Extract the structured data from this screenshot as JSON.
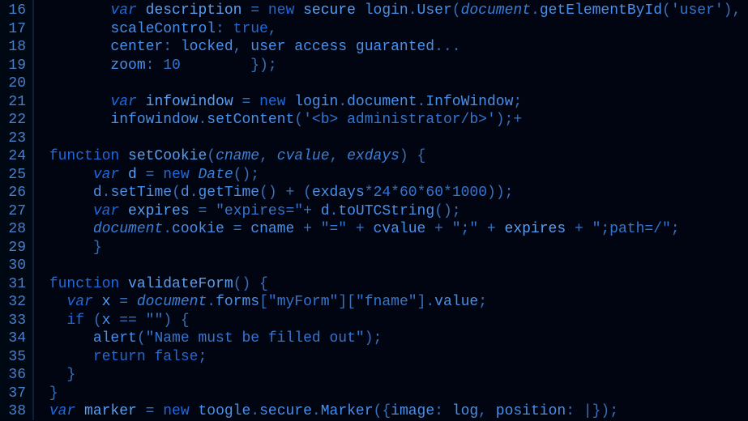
{
  "editor": {
    "startLine": 16,
    "lines": [
      {
        "num": 16,
        "indent": "        ",
        "tokens": [
          {
            "t": "var ",
            "c": "kw"
          },
          {
            "t": "description",
            "c": "bright"
          },
          {
            "t": " = ",
            "c": "punc"
          },
          {
            "t": "new ",
            "c": "kw2"
          },
          {
            "t": "secure ",
            "c": "bright"
          },
          {
            "t": "login",
            "c": "ident"
          },
          {
            "t": ".",
            "c": "punc"
          },
          {
            "t": "User",
            "c": "ident"
          },
          {
            "t": "(",
            "c": "punc"
          },
          {
            "t": "document",
            "c": "param"
          },
          {
            "t": ".",
            "c": "punc"
          },
          {
            "t": "getElementById",
            "c": "ident"
          },
          {
            "t": "(",
            "c": "punc"
          },
          {
            "t": "'user'",
            "c": "str"
          },
          {
            "t": "), {",
            "c": "punc"
          }
        ]
      },
      {
        "num": 17,
        "indent": "        ",
        "tokens": [
          {
            "t": "scaleControl",
            "c": "prop"
          },
          {
            "t": ": ",
            "c": "punc"
          },
          {
            "t": "true",
            "c": "kw2"
          },
          {
            "t": ",",
            "c": "punc"
          }
        ]
      },
      {
        "num": 18,
        "indent": "        ",
        "tokens": [
          {
            "t": "center",
            "c": "prop"
          },
          {
            "t": ": ",
            "c": "punc"
          },
          {
            "t": "locked",
            "c": "ident"
          },
          {
            "t": ", ",
            "c": "punc"
          },
          {
            "t": "user access guaranted",
            "c": "ident"
          },
          {
            "t": "...",
            "c": "punc"
          }
        ]
      },
      {
        "num": 19,
        "indent": "        ",
        "tokens": [
          {
            "t": "zoom",
            "c": "prop"
          },
          {
            "t": ": ",
            "c": "punc"
          },
          {
            "t": "10",
            "c": "num"
          },
          {
            "t": "        });",
            "c": "punc"
          }
        ]
      },
      {
        "num": 20,
        "indent": "",
        "tokens": []
      },
      {
        "num": 21,
        "indent": "        ",
        "tokens": [
          {
            "t": "var ",
            "c": "kw"
          },
          {
            "t": "infowindow",
            "c": "bright"
          },
          {
            "t": " = ",
            "c": "punc"
          },
          {
            "t": "new ",
            "c": "kw2"
          },
          {
            "t": "login",
            "c": "ident"
          },
          {
            "t": ".",
            "c": "punc"
          },
          {
            "t": "document",
            "c": "ident"
          },
          {
            "t": ".",
            "c": "punc"
          },
          {
            "t": "InfoWindow",
            "c": "ident"
          },
          {
            "t": ";",
            "c": "punc"
          }
        ]
      },
      {
        "num": 22,
        "indent": "        ",
        "tokens": [
          {
            "t": "infowindow",
            "c": "ident"
          },
          {
            "t": ".",
            "c": "punc"
          },
          {
            "t": "setContent",
            "c": "ident"
          },
          {
            "t": "(",
            "c": "punc"
          },
          {
            "t": "'<b> administrator/b>'",
            "c": "str"
          },
          {
            "t": ");+",
            "c": "punc"
          }
        ]
      },
      {
        "num": 23,
        "indent": "",
        "tokens": []
      },
      {
        "num": 24,
        "indent": " ",
        "tokens": [
          {
            "t": "function ",
            "c": "kw2"
          },
          {
            "t": "setCookie",
            "c": "bright"
          },
          {
            "t": "(",
            "c": "punc"
          },
          {
            "t": "cname",
            "c": "param"
          },
          {
            "t": ", ",
            "c": "punc"
          },
          {
            "t": "cvalue",
            "c": "param"
          },
          {
            "t": ", ",
            "c": "punc"
          },
          {
            "t": "exdays",
            "c": "param"
          },
          {
            "t": ") {",
            "c": "punc"
          }
        ]
      },
      {
        "num": 25,
        "indent": "      ",
        "tokens": [
          {
            "t": "var ",
            "c": "kw"
          },
          {
            "t": "d",
            "c": "bright"
          },
          {
            "t": " = ",
            "c": "punc"
          },
          {
            "t": "new ",
            "c": "kw2"
          },
          {
            "t": "Date",
            "c": "type"
          },
          {
            "t": "();",
            "c": "punc"
          }
        ]
      },
      {
        "num": 26,
        "indent": "      ",
        "tokens": [
          {
            "t": "d",
            "c": "ident"
          },
          {
            "t": ".",
            "c": "punc"
          },
          {
            "t": "setTime",
            "c": "ident"
          },
          {
            "t": "(",
            "c": "punc"
          },
          {
            "t": "d",
            "c": "ident"
          },
          {
            "t": ".",
            "c": "punc"
          },
          {
            "t": "getTime",
            "c": "ident"
          },
          {
            "t": "() + (",
            "c": "punc"
          },
          {
            "t": "exdays",
            "c": "ident"
          },
          {
            "t": "*",
            "c": "punc"
          },
          {
            "t": "24",
            "c": "num"
          },
          {
            "t": "*",
            "c": "punc"
          },
          {
            "t": "60",
            "c": "num"
          },
          {
            "t": "*",
            "c": "punc"
          },
          {
            "t": "60",
            "c": "num"
          },
          {
            "t": "*",
            "c": "punc"
          },
          {
            "t": "1000",
            "c": "num"
          },
          {
            "t": "));",
            "c": "punc"
          }
        ]
      },
      {
        "num": 27,
        "indent": "      ",
        "tokens": [
          {
            "t": "var ",
            "c": "kw"
          },
          {
            "t": "expires",
            "c": "bright"
          },
          {
            "t": " = ",
            "c": "punc"
          },
          {
            "t": "\"expires=\"",
            "c": "str"
          },
          {
            "t": "+ ",
            "c": "punc"
          },
          {
            "t": "d",
            "c": "ident"
          },
          {
            "t": ".",
            "c": "punc"
          },
          {
            "t": "toUTCString",
            "c": "ident"
          },
          {
            "t": "();",
            "c": "punc"
          }
        ]
      },
      {
        "num": 28,
        "indent": "      ",
        "tokens": [
          {
            "t": "document",
            "c": "param"
          },
          {
            "t": ".",
            "c": "punc"
          },
          {
            "t": "cookie",
            "c": "ident"
          },
          {
            "t": " = ",
            "c": "punc"
          },
          {
            "t": "cname",
            "c": "ident"
          },
          {
            "t": " + ",
            "c": "punc"
          },
          {
            "t": "\"=\"",
            "c": "str"
          },
          {
            "t": " + ",
            "c": "punc"
          },
          {
            "t": "cvalue",
            "c": "ident"
          },
          {
            "t": " + ",
            "c": "punc"
          },
          {
            "t": "\";\"",
            "c": "str"
          },
          {
            "t": " + ",
            "c": "punc"
          },
          {
            "t": "expires",
            "c": "bright"
          },
          {
            "t": " + ",
            "c": "punc"
          },
          {
            "t": "\";path=/\"",
            "c": "str"
          },
          {
            "t": ";",
            "c": "punc"
          }
        ]
      },
      {
        "num": 29,
        "indent": "      ",
        "tokens": [
          {
            "t": "}",
            "c": "punc"
          }
        ]
      },
      {
        "num": 30,
        "indent": "",
        "tokens": []
      },
      {
        "num": 31,
        "indent": " ",
        "tokens": [
          {
            "t": "function ",
            "c": "kw2"
          },
          {
            "t": "validateForm",
            "c": "bright"
          },
          {
            "t": "() {",
            "c": "punc"
          }
        ]
      },
      {
        "num": 32,
        "indent": "   ",
        "tokens": [
          {
            "t": "var ",
            "c": "kw"
          },
          {
            "t": "x",
            "c": "bright"
          },
          {
            "t": " = ",
            "c": "punc"
          },
          {
            "t": "document",
            "c": "param"
          },
          {
            "t": ".",
            "c": "punc"
          },
          {
            "t": "forms",
            "c": "ident"
          },
          {
            "t": "[",
            "c": "punc"
          },
          {
            "t": "\"myForm\"",
            "c": "str"
          },
          {
            "t": "][",
            "c": "punc"
          },
          {
            "t": "\"fname\"",
            "c": "str"
          },
          {
            "t": "].",
            "c": "punc"
          },
          {
            "t": "value",
            "c": "ident"
          },
          {
            "t": ";",
            "c": "punc"
          }
        ]
      },
      {
        "num": 33,
        "indent": "   ",
        "tokens": [
          {
            "t": "if ",
            "c": "kw2"
          },
          {
            "t": "(",
            "c": "punc"
          },
          {
            "t": "x",
            "c": "ident"
          },
          {
            "t": " == ",
            "c": "punc"
          },
          {
            "t": "\"\"",
            "c": "str"
          },
          {
            "t": ") {",
            "c": "punc"
          }
        ]
      },
      {
        "num": 34,
        "indent": "      ",
        "tokens": [
          {
            "t": "alert",
            "c": "ident"
          },
          {
            "t": "(",
            "c": "punc"
          },
          {
            "t": "\"Name must be filled out\"",
            "c": "str"
          },
          {
            "t": ");",
            "c": "punc"
          }
        ]
      },
      {
        "num": 35,
        "indent": "      ",
        "tokens": [
          {
            "t": "return ",
            "c": "kw2"
          },
          {
            "t": "false",
            "c": "kw2"
          },
          {
            "t": ";",
            "c": "punc"
          }
        ]
      },
      {
        "num": 36,
        "indent": "   ",
        "tokens": [
          {
            "t": "}",
            "c": "punc"
          }
        ]
      },
      {
        "num": 37,
        "indent": " ",
        "tokens": [
          {
            "t": "}",
            "c": "punc"
          }
        ]
      },
      {
        "num": 38,
        "indent": " ",
        "tokens": [
          {
            "t": "var ",
            "c": "kw"
          },
          {
            "t": "marker",
            "c": "bright"
          },
          {
            "t": " = ",
            "c": "punc"
          },
          {
            "t": "new ",
            "c": "kw2"
          },
          {
            "t": "toogle",
            "c": "ident"
          },
          {
            "t": ".",
            "c": "punc"
          },
          {
            "t": "secure",
            "c": "ident"
          },
          {
            "t": ".",
            "c": "punc"
          },
          {
            "t": "Marker",
            "c": "ident"
          },
          {
            "t": "({",
            "c": "punc"
          },
          {
            "t": "image",
            "c": "prop"
          },
          {
            "t": ": ",
            "c": "punc"
          },
          {
            "t": "log",
            "c": "ident"
          },
          {
            "t": ", ",
            "c": "punc"
          },
          {
            "t": "position",
            "c": "prop"
          },
          {
            "t": ": |});",
            "c": "punc"
          }
        ]
      }
    ]
  }
}
